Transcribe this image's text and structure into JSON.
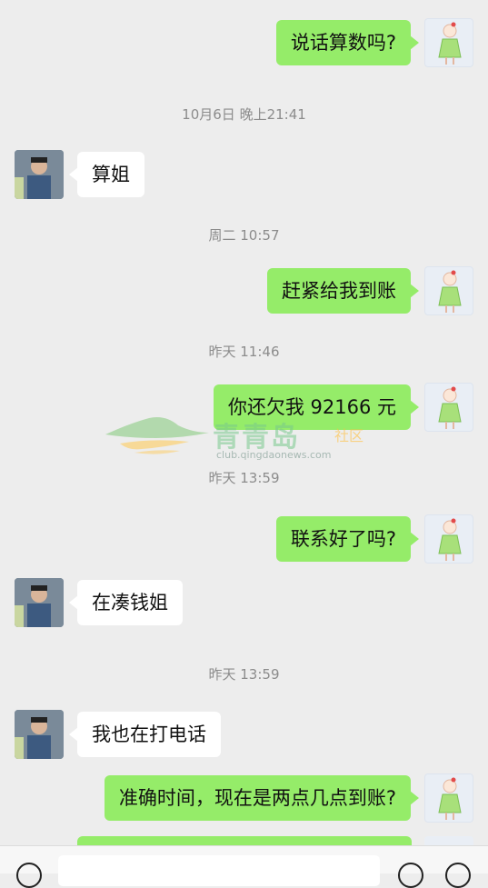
{
  "messages": [
    {
      "id": "m1",
      "sender": "me",
      "text": "说话算数吗?"
    },
    {
      "id": "t1",
      "type": "timestamp",
      "text": "10月6日 晚上21:41"
    },
    {
      "id": "m2",
      "sender": "other",
      "text": "算姐"
    },
    {
      "id": "t2",
      "type": "timestamp",
      "text": "周二 10:57"
    },
    {
      "id": "m3",
      "sender": "me",
      "text": "赶紧给我到账"
    },
    {
      "id": "t3",
      "type": "timestamp",
      "text": "昨天 11:46"
    },
    {
      "id": "m4",
      "sender": "me",
      "text": "你还欠我 92166 元"
    },
    {
      "id": "t4",
      "type": "timestamp",
      "text": "昨天 13:59"
    },
    {
      "id": "m5",
      "sender": "me",
      "text": "联系好了吗?"
    },
    {
      "id": "m6",
      "sender": "other",
      "text": "在凑钱姐"
    },
    {
      "id": "t5",
      "type": "timestamp",
      "text": "昨天 13:59"
    },
    {
      "id": "m7",
      "sender": "other",
      "text": "我也在打电话"
    },
    {
      "id": "m8",
      "sender": "me",
      "text": "准确时间，现在是两点几点到账?"
    }
  ],
  "watermark": {
    "brand": "青青岛",
    "tag": "社区",
    "url": "club.qingdaonews.com"
  },
  "colors": {
    "background": "#ededed",
    "my_bubble": "#95ec69",
    "other_bubble": "#ffffff",
    "timestamp": "#8c8c8c"
  },
  "icons": {
    "voice": "voice-toggle-icon",
    "emoji": "emoji-icon",
    "more": "plus-more-icon"
  }
}
